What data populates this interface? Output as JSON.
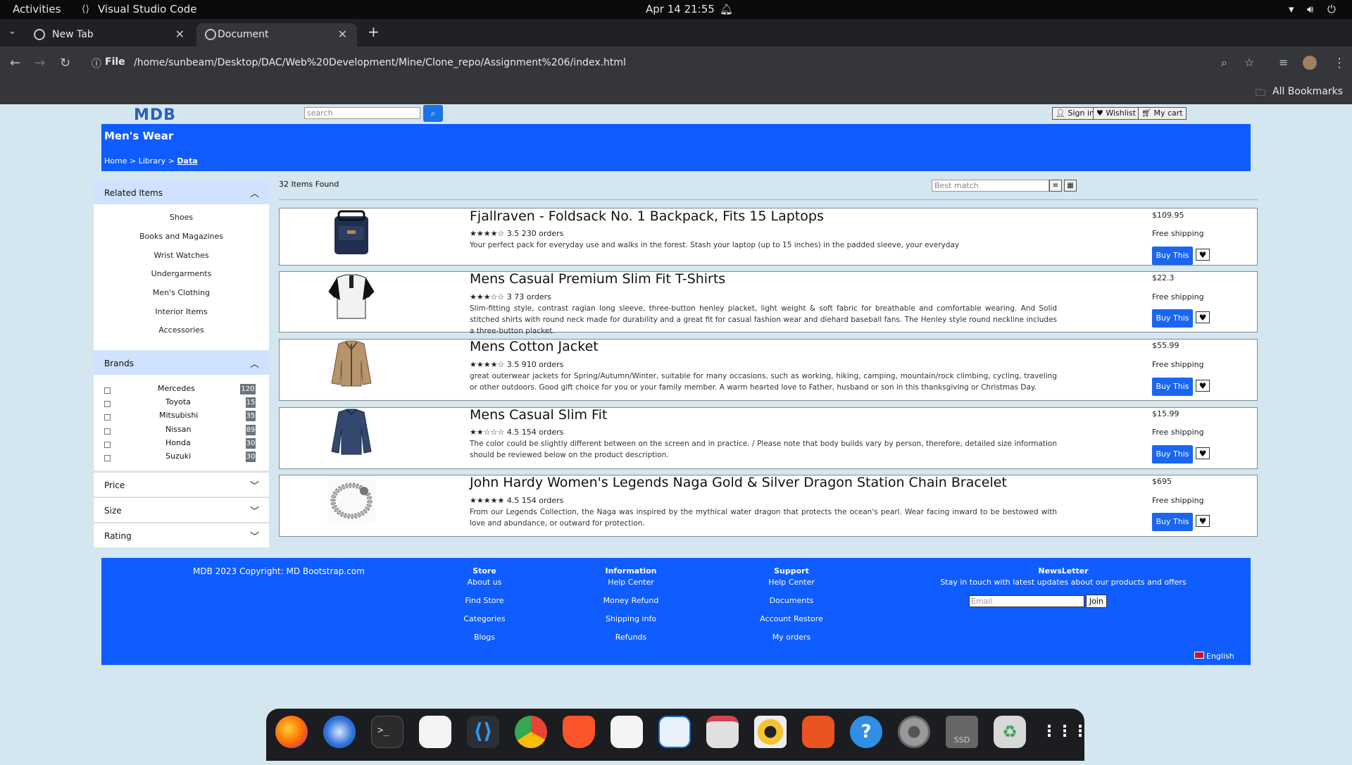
{
  "system": {
    "activities": "Activities",
    "app_name": "Visual Studio Code",
    "datetime": "Apr 14  21:55"
  },
  "browser": {
    "tabs": [
      {
        "label": "New Tab"
      },
      {
        "label": "Document"
      }
    ],
    "url_scheme": "File",
    "url": "/home/sunbeam/Desktop/DAC/Web%20Development/Mine/Clone_repo/Assignment%206/index.html",
    "bookmarks_label": "All Bookmarks"
  },
  "page": {
    "logo": "MDB",
    "search_placeholder": "search",
    "buttons": {
      "signin": "Sign in",
      "wishlist": "Wishlist",
      "cart": "My cart"
    },
    "banner_title": "Men's Wear",
    "breadcrumb": {
      "home": "Home",
      "sep1": " > ",
      "library": "Library",
      "sep2": " > ",
      "current": "Data"
    },
    "items_found": "32 Items Found",
    "sort_placeholder": "Best match",
    "related": {
      "title": "Related Items",
      "items": [
        "Shoes",
        "Books and Magazines",
        "Wrist Watches",
        "Undergarments",
        "Men's Clothing",
        "Interior Items",
        "Accessories"
      ]
    },
    "brands": {
      "title": "Brands",
      "items": [
        {
          "name": "Mercedes",
          "count": "120"
        },
        {
          "name": "Toyota",
          "count": "15"
        },
        {
          "name": "Mitsubishi",
          "count": "35"
        },
        {
          "name": "Nissan",
          "count": "89"
        },
        {
          "name": "Honda",
          "count": "30"
        },
        {
          "name": "Suzuki",
          "count": "30"
        }
      ]
    },
    "filters": [
      "Price",
      "Size",
      "Rating"
    ],
    "products": [
      {
        "title": "Fjallraven - Foldsack No. 1 Backpack, Fits 15 Laptops",
        "stars": "★★★★☆",
        "meta": "3.5 230 orders",
        "desc": "Your perfect pack for everyday use and walks in the forest. Stash your laptop (up to 15 inches) in the padded sleeve, your everyday",
        "price": "$109.95",
        "shipping": "Free shipping",
        "buy": "Buy This"
      },
      {
        "title": "Mens Casual Premium Slim Fit T-Shirts",
        "stars": "★★★☆☆",
        "meta": "3 73 orders",
        "desc": "Slim-fitting style, contrast raglan long sleeve, three-button henley placket, light weight & soft fabric for breathable and comfortable wearing. And Solid stitched shirts with round neck made for durability and a great fit for casual fashion wear and diehard baseball fans. The Henley style round neckline includes a three-button placket.",
        "price": "$22.3",
        "shipping": "Free shipping",
        "buy": "Buy This"
      },
      {
        "title": "Mens Cotton Jacket",
        "stars": "★★★★☆",
        "meta": "3.5 910 orders",
        "desc": "great outerwear jackets for Spring/Autumn/Winter, suitable for many occasions, such as working, hiking, camping, mountain/rock climbing, cycling, traveling or other outdoors. Good gift choice for you or your family member. A warm hearted love to Father, husband or son in this thanksgiving or Christmas Day.",
        "price": "$55.99",
        "shipping": "Free shipping",
        "buy": "Buy This"
      },
      {
        "title": "Mens Casual Slim Fit",
        "stars": "★★☆☆☆",
        "meta": "4.5 154 orders",
        "desc": "The color could be slightly different between on the screen and in practice. / Please note that body builds vary by person, therefore, detailed size information should be reviewed below on the product description.",
        "price": "$15.99",
        "shipping": "Free shipping",
        "buy": "Buy This"
      },
      {
        "title": "John Hardy Women's Legends Naga Gold & Silver Dragon Station Chain Bracelet",
        "stars": "★★★★★",
        "meta": "4.5 154 orders",
        "desc": "From our Legends Collection, the Naga was inspired by the mythical water dragon that protects the ocean's pearl. Wear facing inward to be bestowed with love and abundance, or outward for protection.",
        "price": "$695",
        "shipping": "Free shipping",
        "buy": "Buy This"
      }
    ],
    "footer": {
      "copyright": "MDB 2023 Copyright: MD Bootstrap.com",
      "store": {
        "title": "Store",
        "links": [
          "About us",
          "Find Store",
          "Categories",
          "Blogs"
        ]
      },
      "information": {
        "title": "Information",
        "links": [
          "Help Center",
          "Money Refund",
          "Shipping info",
          "Refunds"
        ]
      },
      "support": {
        "title": "Support",
        "links": [
          "Help Center",
          "Documents",
          "Account Restore",
          "My orders"
        ]
      },
      "newsletter": {
        "title": "NewsLetter",
        "text": "Stay in touch with latest updates about our products and offers",
        "email_placeholder": "Email",
        "join": "Join"
      },
      "language": "English"
    }
  },
  "dock": [
    "firefox-icon",
    "thunderbird-icon",
    "terminal-icon",
    "text-viewer-icon",
    "vscode-icon",
    "chrome-icon",
    "brave-icon",
    "text-editor-icon",
    "writer-icon",
    "files-icon",
    "rhythmbox-icon",
    "app-center-icon",
    "help-icon",
    "settings-icon",
    "ssd-icon",
    "trash-icon",
    "apps-grid-icon"
  ],
  "colors": {
    "banner": "#0f5cff",
    "page_bg": "#d4e6ef",
    "accent": "#1a66f0"
  }
}
